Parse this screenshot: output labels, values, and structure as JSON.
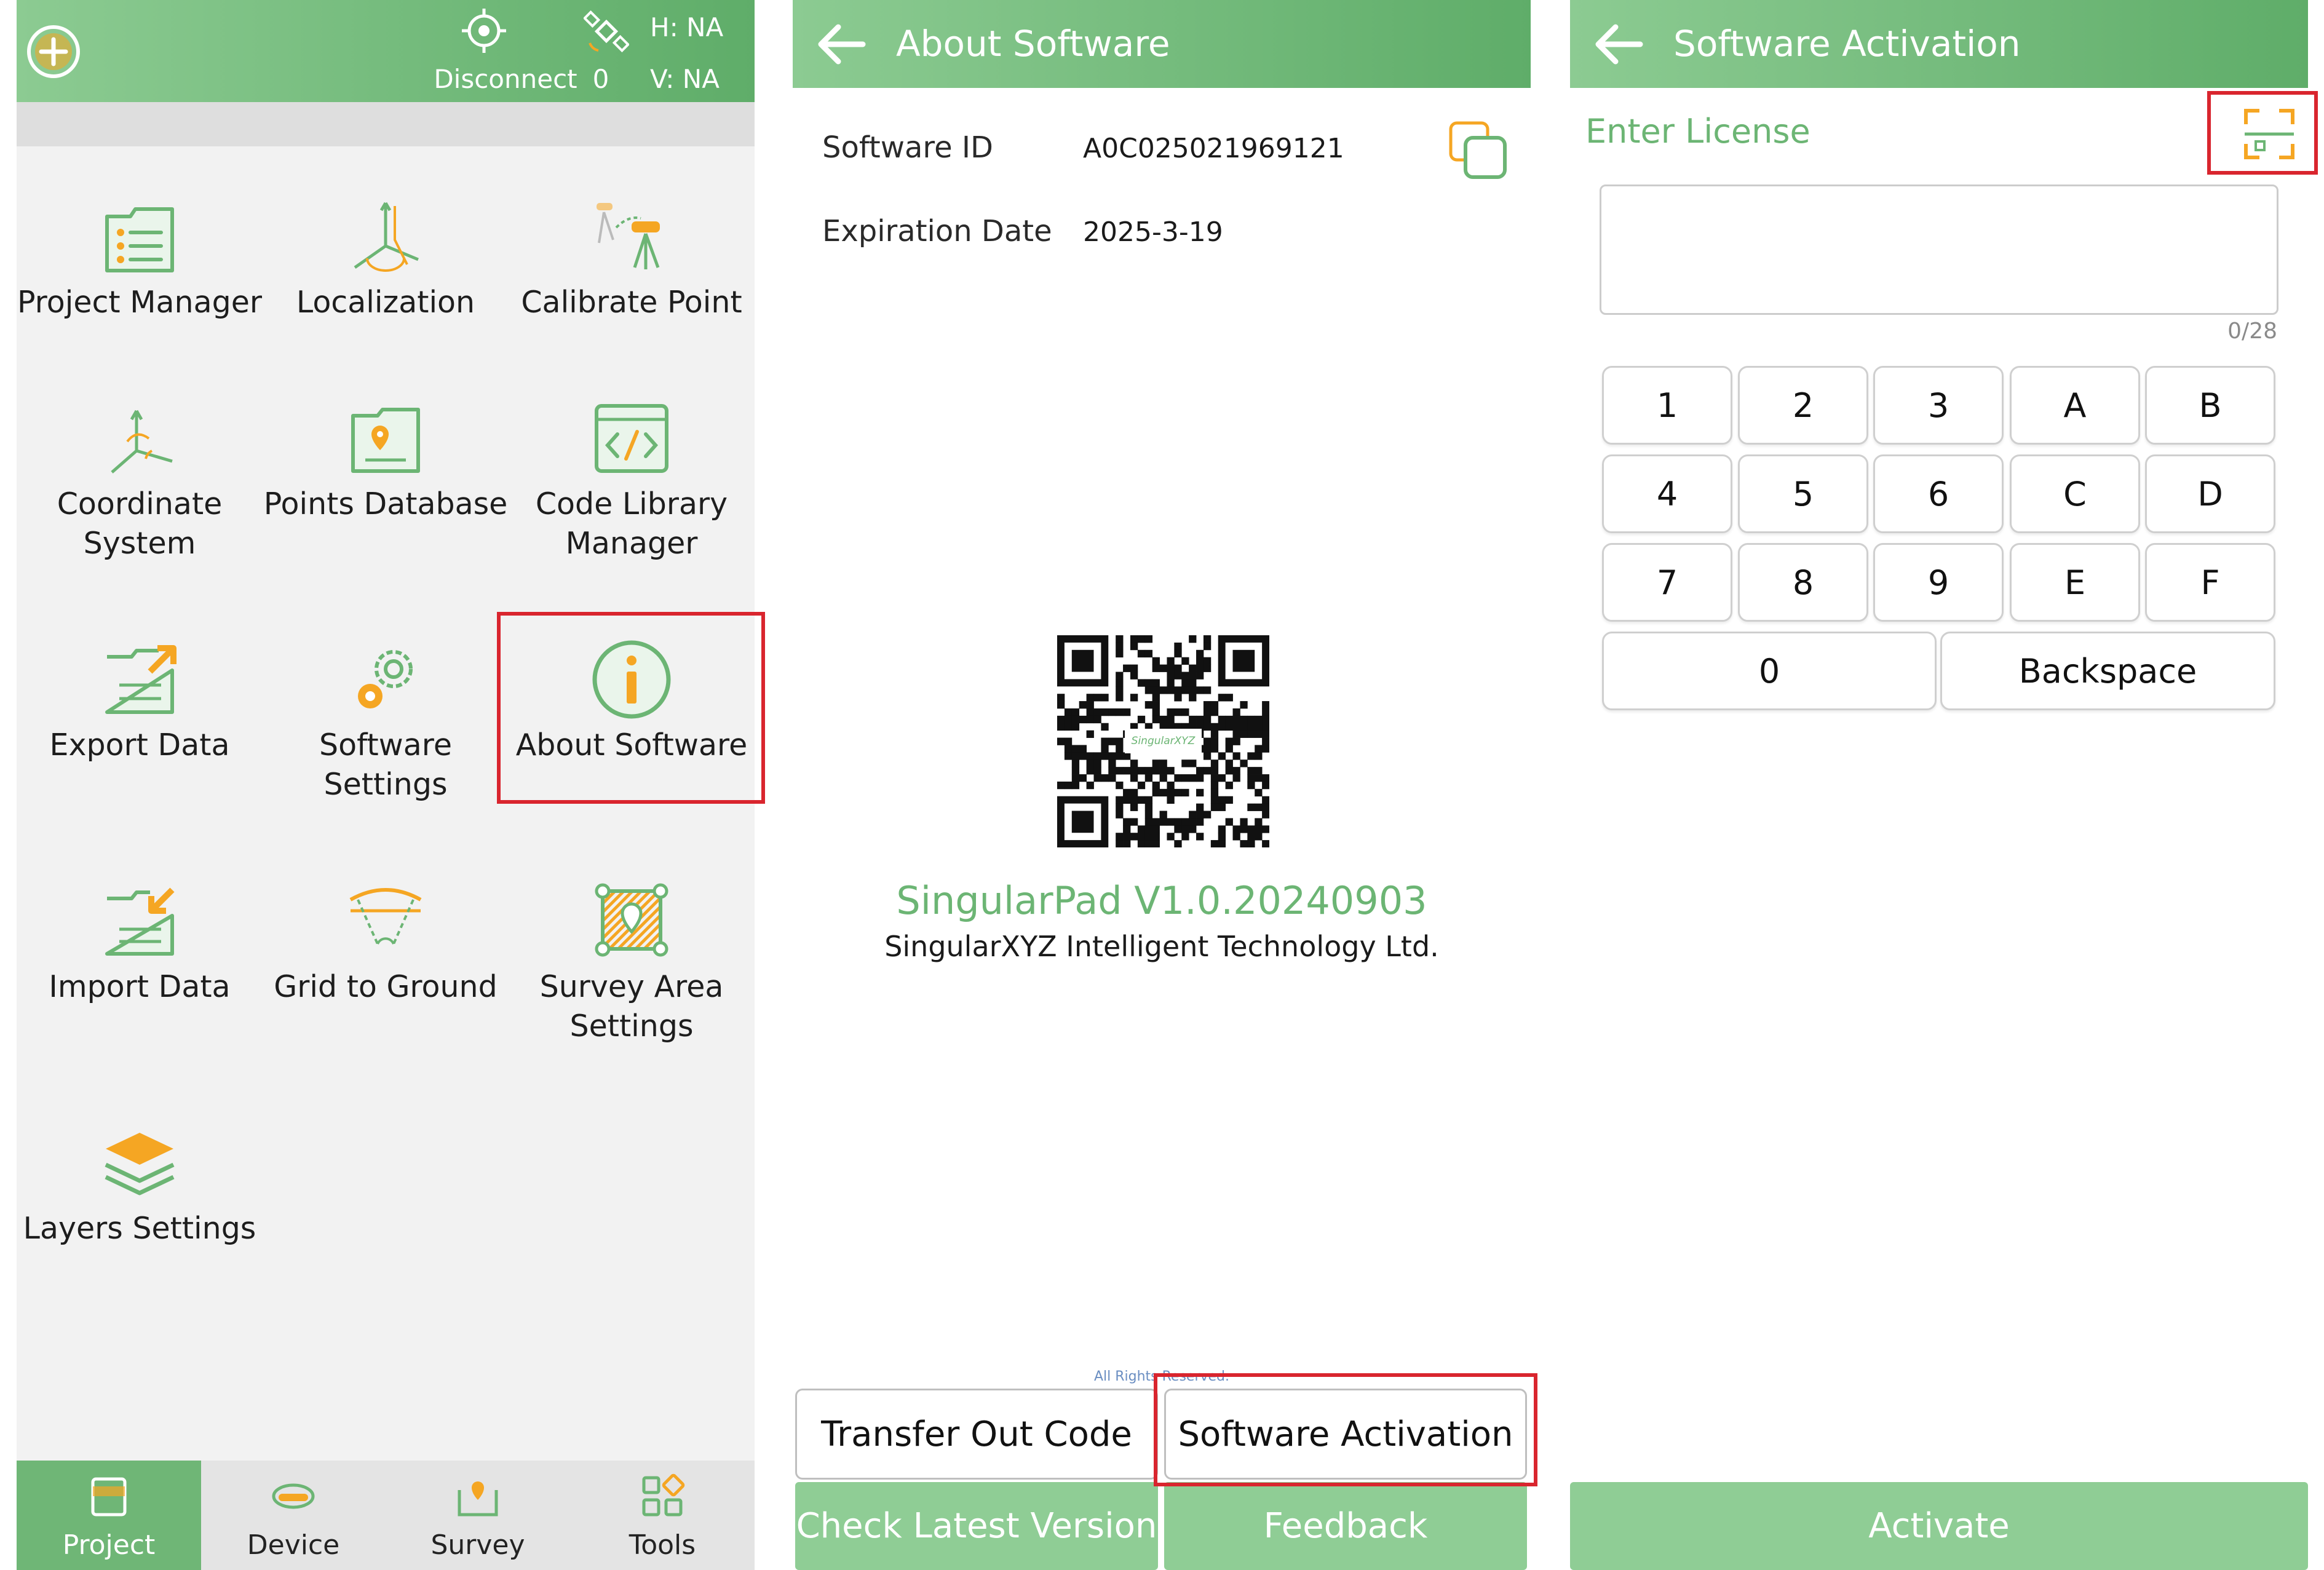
{
  "colors": {
    "brand_green": "#6cb574",
    "accent_orange": "#f5a623",
    "highlight_red": "#d9252e"
  },
  "left_panel": {
    "status": {
      "disconnect_label": "Disconnect",
      "satellite_count": "0",
      "h_precision": "H: NA",
      "v_precision": "V: NA"
    },
    "tiles": [
      {
        "label": "Project Manager",
        "icon": "project-manager-icon"
      },
      {
        "label": "Localization",
        "icon": "localization-icon"
      },
      {
        "label": "Calibrate Point",
        "icon": "calibrate-point-icon"
      },
      {
        "label": "Coordinate\nSystem",
        "icon": "coordinate-system-icon"
      },
      {
        "label": "Points Database",
        "icon": "points-database-icon"
      },
      {
        "label": "Code Library\nManager",
        "icon": "code-library-icon"
      },
      {
        "label": "Export Data",
        "icon": "export-data-icon"
      },
      {
        "label": "Software\nSettings",
        "icon": "software-settings-icon"
      },
      {
        "label": "About Software",
        "icon": "about-software-icon"
      },
      {
        "label": "Import Data",
        "icon": "import-data-icon"
      },
      {
        "label": "Grid to Ground",
        "icon": "grid-to-ground-icon"
      },
      {
        "label": "Survey Area\nSettings",
        "icon": "survey-area-icon"
      },
      {
        "label": "Layers Settings",
        "icon": "layers-icon"
      }
    ],
    "bottom_nav": [
      {
        "label": "Project",
        "active": true
      },
      {
        "label": "Device",
        "active": false
      },
      {
        "label": "Survey",
        "active": false
      },
      {
        "label": "Tools",
        "active": false
      }
    ]
  },
  "about_panel": {
    "title": "About Software",
    "software_id_label": "Software ID",
    "software_id": "A0C025021969121",
    "expiration_label": "Expiration Date",
    "expiration_date": "2025-3-19",
    "qr_logo_text": "SingularXYZ",
    "version": "SingularPad V1.0.20240903",
    "company": "SingularXYZ Intelligent Technology Ltd.",
    "rights": "All Rights Reserved.",
    "transfer_button": "Transfer Out Code",
    "activation_button": "Software Activation",
    "check_version_button": "Check Latest Version",
    "feedback_button": "Feedback"
  },
  "activation_panel": {
    "title": "Software Activation",
    "enter_license_label": "Enter License",
    "license_value": "",
    "char_count": "0/28",
    "keys": [
      "1",
      "2",
      "3",
      "A",
      "B",
      "4",
      "5",
      "6",
      "C",
      "D",
      "7",
      "8",
      "9",
      "E",
      "F"
    ],
    "zero_key": "0",
    "backspace_key": "Backspace",
    "activate_button": "Activate"
  }
}
